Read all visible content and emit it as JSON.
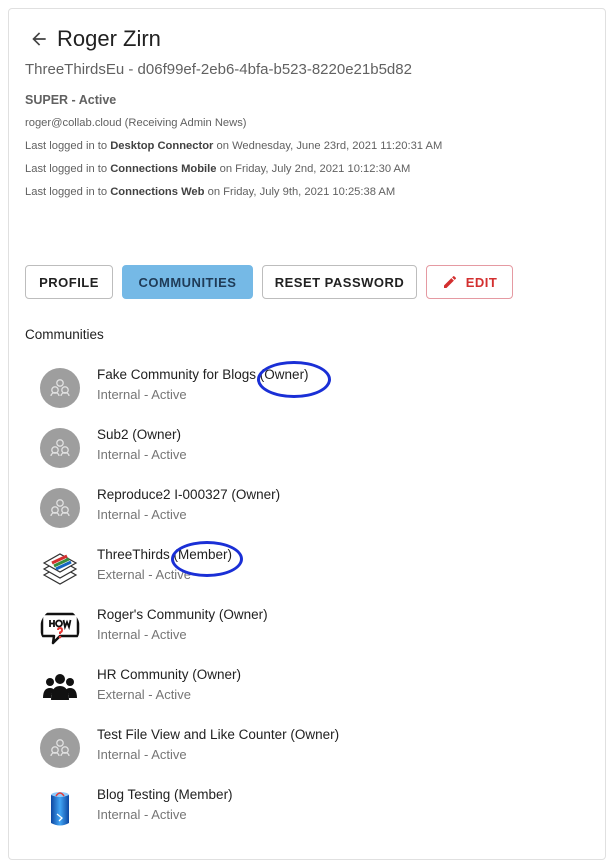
{
  "header": {
    "title": "Roger Zirn",
    "subtitle": "ThreeThirdsEu - d06f99ef-2eb6-4bfa-b523-8220e21b5d82",
    "role": "SUPER - Active",
    "email_line": "roger@collab.cloud (Receiving Admin News)",
    "logins": [
      {
        "prefix": "Last logged in to ",
        "app": "Desktop Connector",
        "suffix": " on Wednesday, June 23rd, 2021 11:20:31 AM"
      },
      {
        "prefix": "Last logged in to ",
        "app": "Connections Mobile",
        "suffix": " on Friday, July 2nd, 2021 10:12:30 AM"
      },
      {
        "prefix": "Last logged in to ",
        "app": "Connections Web",
        "suffix": " on Friday, July 9th, 2021 10:25:38 AM"
      }
    ]
  },
  "buttons": {
    "profile": "PROFILE",
    "communities": "COMMUNITIES",
    "reset_password": "RESET PASSWORD",
    "edit": "EDIT"
  },
  "communities": {
    "section_title": "Communities",
    "items": [
      {
        "name": "Fake Community for Blogs (Owner)",
        "status": "Internal - Active",
        "icon": "community-placeholder-icon"
      },
      {
        "name": "Sub2 (Owner)",
        "status": "Internal - Active",
        "icon": "community-placeholder-icon"
      },
      {
        "name": "Reproduce2 I-000327 (Owner)",
        "status": "Internal - Active",
        "icon": "community-placeholder-icon"
      },
      {
        "name": "ThreeThirds (Member)",
        "status": "External - Active",
        "icon": "stacked-layers-logo"
      },
      {
        "name": "Roger's Community (Owner)",
        "status": "Internal - Active",
        "icon": "how-speech-bubble-logo"
      },
      {
        "name": "HR Community (Owner)",
        "status": "External - Active",
        "icon": "people-group-icon"
      },
      {
        "name": "Test File View and Like Counter (Owner)",
        "status": "Internal - Active",
        "icon": "community-placeholder-icon"
      },
      {
        "name": "Blog Testing (Member)",
        "status": "Internal - Active",
        "icon": "blue-bottle-logo"
      }
    ]
  },
  "colors": {
    "active_button": "#75b9e6",
    "edit_red": "#d32f2f",
    "annotation_blue": "#1a2fd6"
  }
}
